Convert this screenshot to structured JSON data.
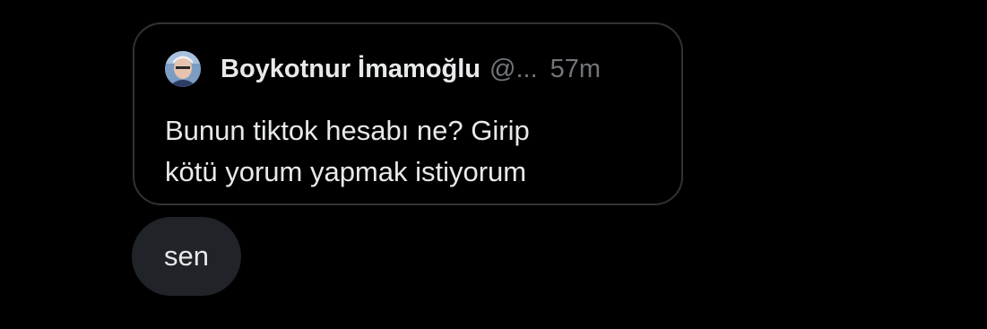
{
  "quoted_post": {
    "display_name": "Boykotnur İmamoğlu",
    "handle": "@...",
    "time_ago": "57m",
    "text_line_1": "Bunun tiktok hesabı ne? Girip",
    "text_line_2": "kötü yorum yapmak istiyorum",
    "avatar_icon": "profile-photo"
  },
  "reply_message": {
    "text": "sen"
  },
  "colors": {
    "background": "#000000",
    "card_border": "#2f3336",
    "primary_text": "#e7e9ea",
    "secondary_text": "#71767b",
    "bubble": "#202327"
  }
}
